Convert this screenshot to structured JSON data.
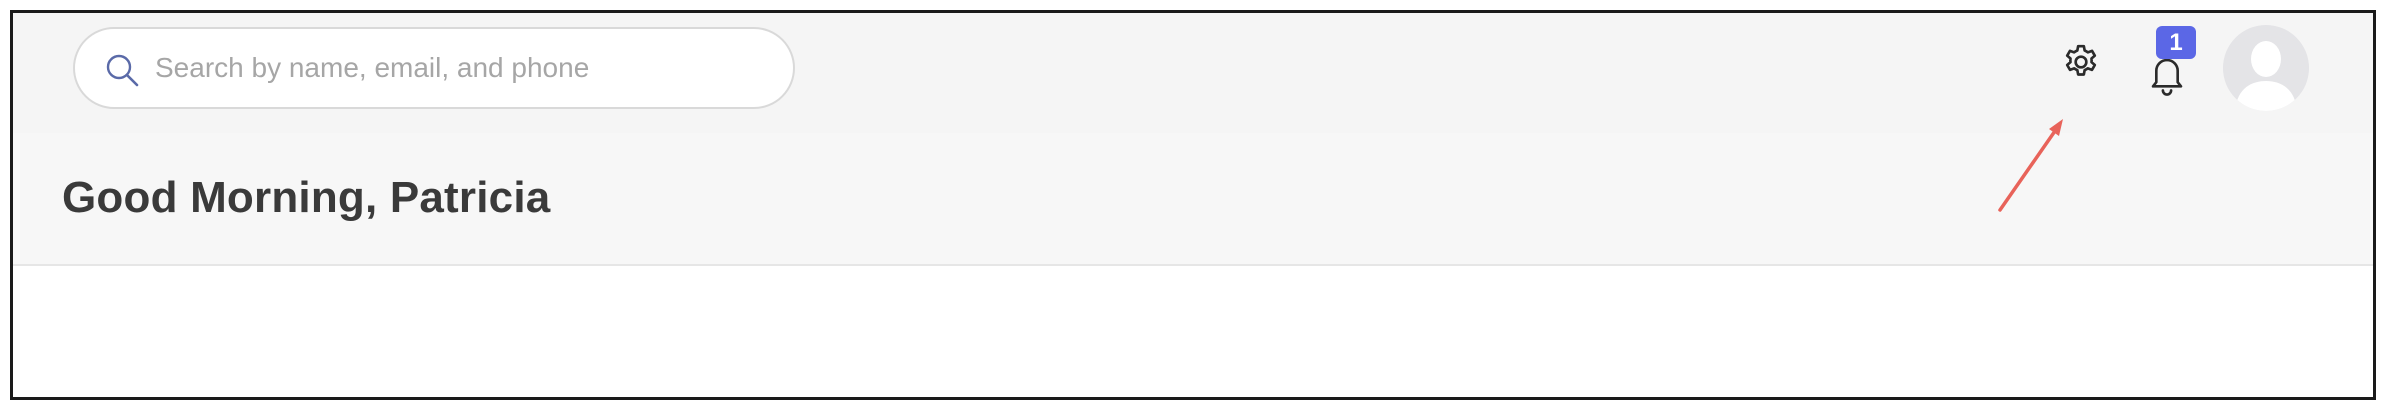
{
  "search": {
    "placeholder": "Search by name, email, and phone",
    "value": "",
    "icon": "search-icon"
  },
  "toolbar": {
    "settings_icon": "gear-icon",
    "notifications_icon": "bell-icon",
    "notification_count": "1",
    "badge_color": "#5b67e6",
    "avatar_icon": "user-placeholder-icon"
  },
  "page": {
    "greeting": "Good Morning, Patricia"
  },
  "annotation": {
    "arrow_color": "#e8635a"
  }
}
